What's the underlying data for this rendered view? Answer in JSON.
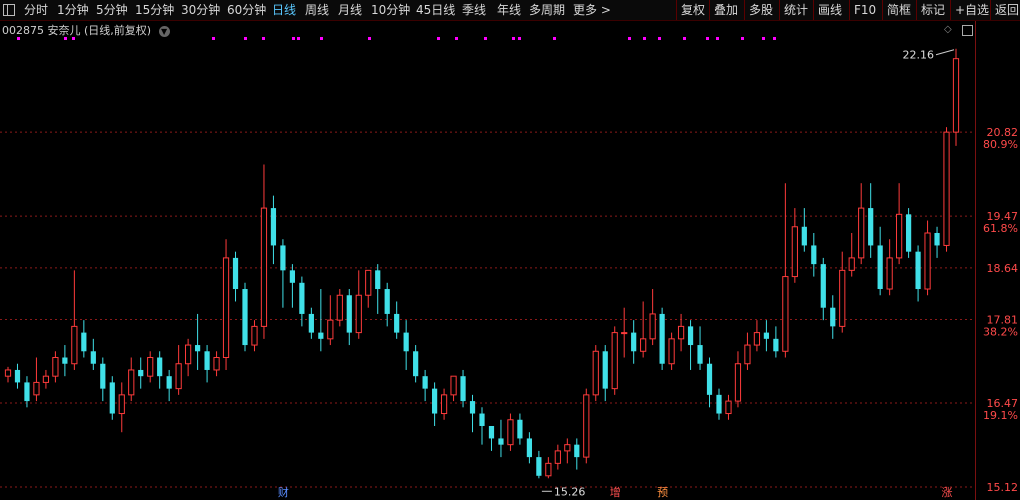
{
  "toolbar": {
    "left_items": [
      "分时",
      "1分钟",
      "5分钟",
      "15分钟",
      "30分钟",
      "60分钟",
      "日线",
      "周线",
      "月线",
      "10分钟",
      "45日线",
      "季线",
      "年线",
      "多周期",
      "更多 >"
    ],
    "active_item": "日线",
    "right_items": [
      "复权",
      "叠加",
      "多股",
      "统计",
      "画线",
      "F10",
      "简框",
      "标记",
      "+自选",
      "返回"
    ]
  },
  "header": {
    "code": "002875",
    "name": "安奈儿",
    "mode": "(日线,前复权)"
  },
  "price_labels": [
    {
      "value": "20.82",
      "pct": "80.9%"
    },
    {
      "value": "19.47",
      "pct": "61.8%"
    },
    {
      "value": "18.64",
      "pct": ""
    },
    {
      "value": "17.81",
      "pct": "38.2%"
    },
    {
      "value": "16.47",
      "pct": "19.1%"
    },
    {
      "value": "15.12",
      "pct": ""
    }
  ],
  "annotations": {
    "high": "22.16",
    "low": "15.26"
  },
  "events": [
    {
      "label": "财",
      "index": 29,
      "color": "#5a8cff"
    },
    {
      "label": "增",
      "index": 64,
      "color": "#ff5050"
    },
    {
      "label": "预",
      "index": 69,
      "color": "#ff9040"
    },
    {
      "label": "涨",
      "index": 99,
      "color": "#ff5050"
    }
  ],
  "colors": {
    "up": "#ff3b3b",
    "down": "#40e0e8",
    "dot": "#ff00ff",
    "grid": "#8b1a1a"
  },
  "chart_data": {
    "type": "candlestick",
    "y_range": [
      15.12,
      22.3
    ],
    "candles": [
      [
        16.9,
        17.0,
        16.8,
        17.05
      ],
      [
        17.0,
        16.8,
        16.7,
        17.1
      ],
      [
        16.8,
        16.5,
        16.4,
        16.9
      ],
      [
        16.6,
        16.8,
        16.5,
        17.2
      ],
      [
        16.8,
        16.9,
        16.7,
        17.0
      ],
      [
        16.9,
        17.2,
        16.8,
        17.3
      ],
      [
        17.2,
        17.1,
        16.9,
        17.4
      ],
      [
        17.1,
        17.7,
        17.0,
        18.6
      ],
      [
        17.6,
        17.3,
        17.2,
        17.8
      ],
      [
        17.3,
        17.1,
        17.0,
        17.5
      ],
      [
        17.1,
        16.7,
        16.5,
        17.2
      ],
      [
        16.8,
        16.3,
        16.2,
        16.9
      ],
      [
        16.3,
        16.6,
        16.0,
        16.8
      ],
      [
        16.6,
        17.0,
        16.5,
        17.2
      ],
      [
        17.0,
        16.9,
        16.7,
        17.2
      ],
      [
        16.9,
        17.2,
        16.8,
        17.3
      ],
      [
        17.2,
        16.9,
        16.7,
        17.3
      ],
      [
        16.9,
        16.7,
        16.5,
        17.0
      ],
      [
        16.7,
        17.1,
        16.6,
        17.4
      ],
      [
        17.1,
        17.4,
        16.9,
        17.5
      ],
      [
        17.4,
        17.3,
        17.0,
        17.9
      ],
      [
        17.3,
        17.0,
        16.8,
        17.4
      ],
      [
        17.0,
        17.2,
        16.9,
        17.3
      ],
      [
        17.2,
        18.8,
        17.0,
        19.1
      ],
      [
        18.8,
        18.3,
        18.1,
        18.9
      ],
      [
        18.3,
        17.4,
        17.3,
        18.4
      ],
      [
        17.4,
        17.7,
        17.3,
        17.8
      ],
      [
        17.7,
        19.6,
        17.5,
        20.3
      ],
      [
        19.6,
        19.0,
        18.7,
        19.8
      ],
      [
        19.0,
        18.6,
        18.0,
        19.1
      ],
      [
        18.6,
        18.4,
        18.0,
        18.7
      ],
      [
        18.4,
        17.9,
        17.7,
        18.5
      ],
      [
        17.9,
        17.6,
        17.5,
        18.0
      ],
      [
        17.6,
        17.5,
        17.3,
        18.3
      ],
      [
        17.5,
        17.8,
        17.4,
        18.2
      ],
      [
        17.8,
        18.2,
        17.7,
        18.3
      ],
      [
        18.2,
        17.6,
        17.4,
        18.3
      ],
      [
        17.6,
        18.2,
        17.5,
        18.6
      ],
      [
        18.2,
        18.6,
        18.0,
        18.6
      ],
      [
        18.6,
        18.3,
        17.9,
        18.7
      ],
      [
        18.3,
        17.9,
        17.7,
        18.4
      ],
      [
        17.9,
        17.6,
        17.5,
        18.1
      ],
      [
        17.6,
        17.3,
        17.0,
        17.8
      ],
      [
        17.3,
        16.9,
        16.8,
        17.4
      ],
      [
        16.9,
        16.7,
        16.5,
        17.0
      ],
      [
        16.7,
        16.3,
        16.1,
        16.8
      ],
      [
        16.3,
        16.6,
        16.2,
        16.7
      ],
      [
        16.6,
        16.9,
        16.5,
        16.9
      ],
      [
        16.9,
        16.5,
        16.4,
        17.0
      ],
      [
        16.5,
        16.3,
        16.0,
        16.6
      ],
      [
        16.3,
        16.1,
        15.8,
        16.4
      ],
      [
        16.1,
        15.9,
        15.7,
        16.1
      ],
      [
        15.9,
        15.8,
        15.6,
        16.2
      ],
      [
        15.8,
        16.2,
        15.7,
        16.3
      ],
      [
        16.2,
        15.9,
        15.8,
        16.3
      ],
      [
        15.9,
        15.6,
        15.5,
        16.0
      ],
      [
        15.6,
        15.3,
        15.26,
        15.7
      ],
      [
        15.3,
        15.5,
        15.26,
        15.6
      ],
      [
        15.5,
        15.7,
        15.4,
        15.8
      ],
      [
        15.7,
        15.8,
        15.5,
        15.9
      ],
      [
        15.8,
        15.6,
        15.4,
        15.9
      ],
      [
        15.6,
        16.6,
        15.5,
        16.7
      ],
      [
        16.6,
        17.3,
        16.5,
        17.4
      ],
      [
        17.3,
        16.7,
        16.5,
        17.4
      ],
      [
        16.7,
        17.6,
        16.6,
        17.7
      ],
      [
        17.6,
        17.6,
        17.2,
        18.0
      ],
      [
        17.6,
        17.3,
        17.1,
        17.8
      ],
      [
        17.3,
        17.5,
        17.2,
        18.1
      ],
      [
        17.5,
        17.9,
        17.4,
        18.3
      ],
      [
        17.9,
        17.1,
        17.0,
        18.0
      ],
      [
        17.1,
        17.5,
        17.0,
        17.6
      ],
      [
        17.5,
        17.7,
        17.3,
        17.9
      ],
      [
        17.7,
        17.4,
        17.0,
        17.8
      ],
      [
        17.4,
        17.1,
        17.0,
        17.7
      ],
      [
        17.1,
        16.6,
        16.4,
        17.2
      ],
      [
        16.6,
        16.3,
        16.2,
        16.7
      ],
      [
        16.3,
        16.5,
        16.2,
        16.6
      ],
      [
        16.5,
        17.1,
        16.4,
        17.3
      ],
      [
        17.1,
        17.4,
        17.0,
        17.6
      ],
      [
        17.4,
        17.6,
        17.3,
        17.8
      ],
      [
        17.6,
        17.5,
        17.3,
        17.8
      ],
      [
        17.5,
        17.3,
        17.2,
        17.7
      ],
      [
        17.3,
        18.5,
        17.2,
        20.0
      ],
      [
        18.5,
        19.3,
        18.4,
        19.6
      ],
      [
        19.3,
        19.0,
        18.9,
        19.6
      ],
      [
        19.0,
        18.7,
        18.5,
        19.2
      ],
      [
        18.7,
        18.0,
        17.8,
        18.8
      ],
      [
        18.0,
        17.7,
        17.5,
        18.2
      ],
      [
        17.7,
        18.6,
        17.6,
        18.9
      ],
      [
        18.6,
        18.8,
        18.5,
        19.2
      ],
      [
        18.8,
        19.6,
        18.7,
        20.0
      ],
      [
        19.6,
        19.0,
        18.8,
        20.0
      ],
      [
        19.0,
        18.3,
        18.2,
        19.3
      ],
      [
        18.3,
        18.8,
        18.2,
        19.1
      ],
      [
        18.8,
        19.5,
        18.7,
        20.0
      ],
      [
        19.5,
        18.9,
        18.8,
        19.6
      ],
      [
        18.9,
        18.3,
        18.1,
        19.0
      ],
      [
        18.3,
        19.2,
        18.2,
        19.4
      ],
      [
        19.2,
        19.0,
        18.8,
        19.3
      ],
      [
        19.0,
        20.82,
        18.9,
        20.9
      ],
      [
        20.82,
        22.0,
        20.6,
        22.16
      ]
    ]
  }
}
